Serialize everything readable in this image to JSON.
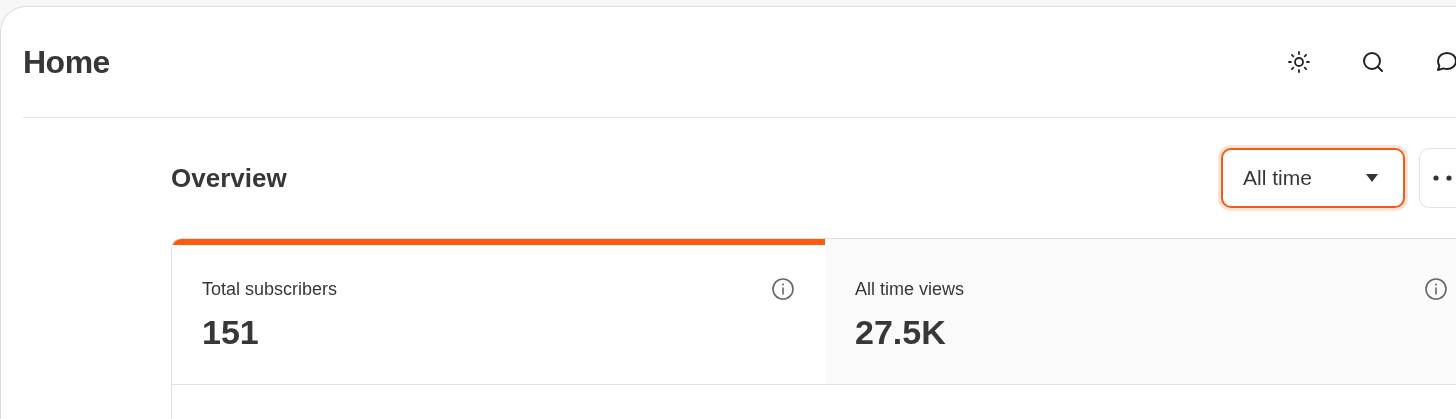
{
  "header": {
    "title": "Home"
  },
  "overview": {
    "title": "Overview",
    "period_dropdown": {
      "value": "All time"
    },
    "stats": [
      {
        "label": "Total subscribers",
        "value": "151",
        "selected": true
      },
      {
        "label": "All time views",
        "value": "27.5K",
        "selected": false
      }
    ]
  }
}
